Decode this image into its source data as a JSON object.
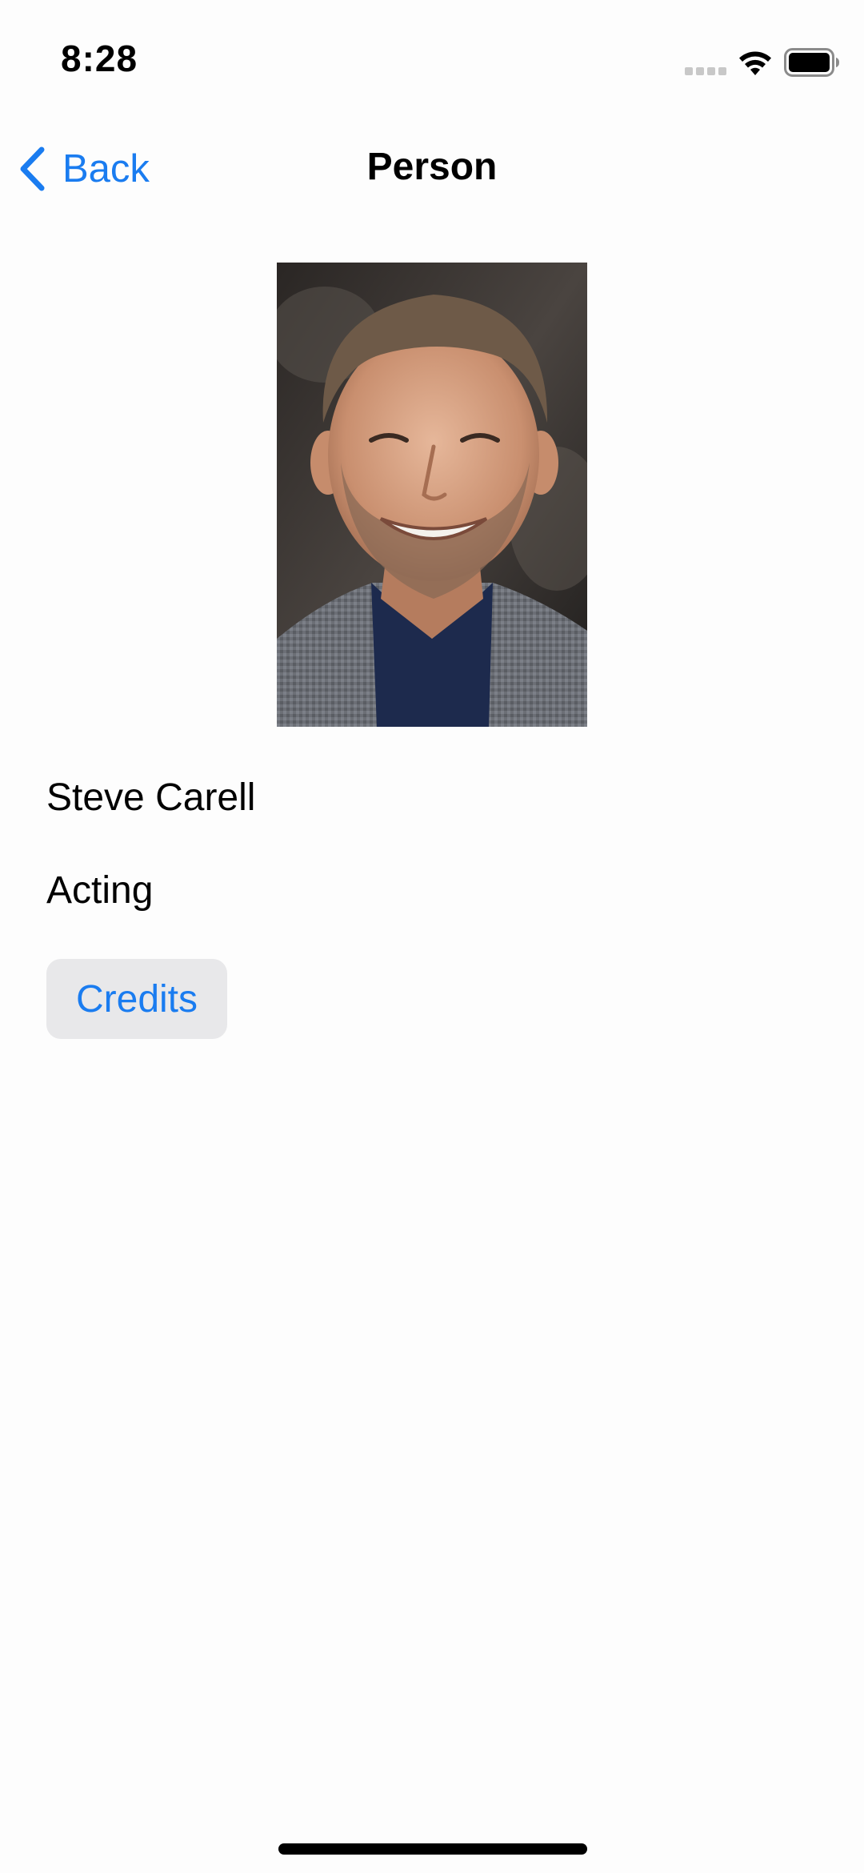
{
  "status_bar": {
    "time": "8:28",
    "icons": [
      "cellular-signal-icon",
      "wifi-icon",
      "battery-icon"
    ]
  },
  "nav": {
    "back_label": "Back",
    "title": "Person"
  },
  "person": {
    "name": "Steve Carell",
    "department": "Acting",
    "photo_alt": "Steve Carell"
  },
  "actions": {
    "credits_label": "Credits"
  },
  "colors": {
    "accent": "#1a7cf0",
    "button_background": "#e8e8ea",
    "background": "#fdfdfd"
  }
}
